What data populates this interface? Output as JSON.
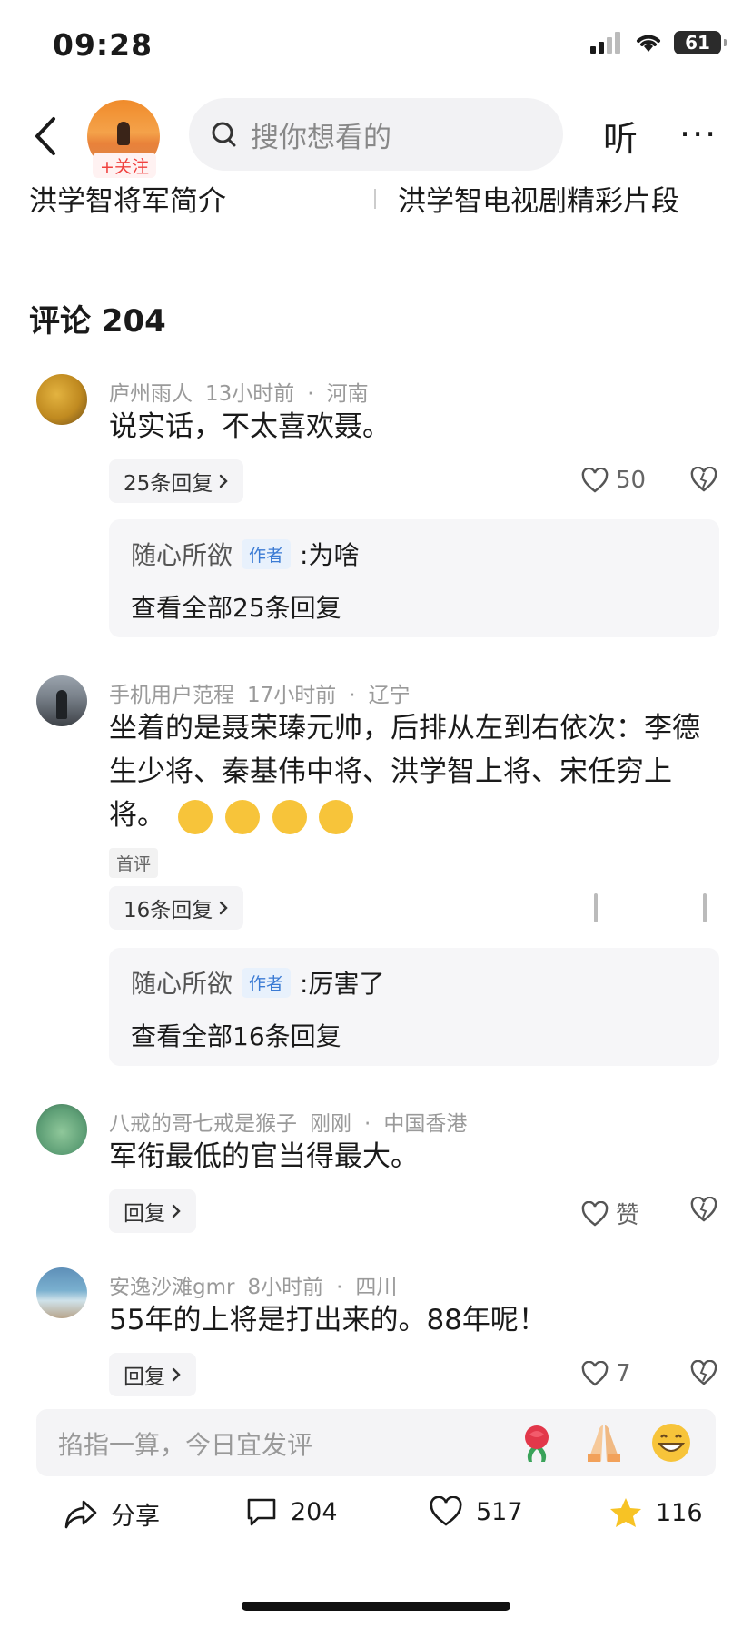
{
  "status_bar": {
    "time": "09:28",
    "battery": "61"
  },
  "header": {
    "follow_label": "+关注",
    "search_placeholder": "搜你想看的",
    "listen_label": "听",
    "more_label": "···"
  },
  "related": {
    "link1": "洪学智将军简介",
    "link2": "洪学智电视剧精彩片段"
  },
  "comments_title": "评论 204",
  "comments": [
    {
      "user": "庐州雨人",
      "time": "13小时前",
      "location": "河南",
      "text": "说实话，不太喜欢聂。",
      "reply_pill": "25条回复",
      "likes": "50",
      "reply": {
        "user": "随心所欲",
        "tag": "作者",
        "text": ":为啥",
        "view_all": "查看全部25条回复"
      }
    },
    {
      "user": "手机用户范程",
      "time": "17小时前",
      "location": "辽宁",
      "text": "坐着的是聂荣瑧元帅，后排从左到右依次：李德生少将、秦基伟中将、洪学智上将、宋任穷上将。",
      "first_tag": "首评",
      "reply_pill": "16条回复",
      "reply": {
        "user": "随心所欲",
        "tag": "作者",
        "text": ":厉害了",
        "view_all": "查看全部16条回复"
      }
    },
    {
      "user": "八戒的哥七戒是猴子",
      "time": "刚刚",
      "location": "中国香港",
      "text": "军衔最低的官当得最大。",
      "reply_pill": "回复",
      "likes": "赞"
    },
    {
      "user": "安逸沙滩gmr",
      "time": "8小时前",
      "location": "四川",
      "text": "55年的上将是打出来的。88年呢！",
      "reply_pill": "回复",
      "likes": "7"
    }
  ],
  "input_placeholder": "掐指一算，今日宜发评",
  "actions": {
    "share": "分享",
    "comments": "204",
    "likes": "517",
    "favorites": "116"
  },
  "icons": [
    "back-icon",
    "search-icon",
    "heart-icon",
    "broken-heart-icon",
    "share-icon",
    "comment-icon",
    "star-icon",
    "rose-emoji",
    "pray-emoji",
    "grin-emoji"
  ],
  "colors": {
    "accent_red": "#f0413f",
    "author_tag_blue": "#3b7bd4",
    "star_yellow": "#f7c325"
  }
}
